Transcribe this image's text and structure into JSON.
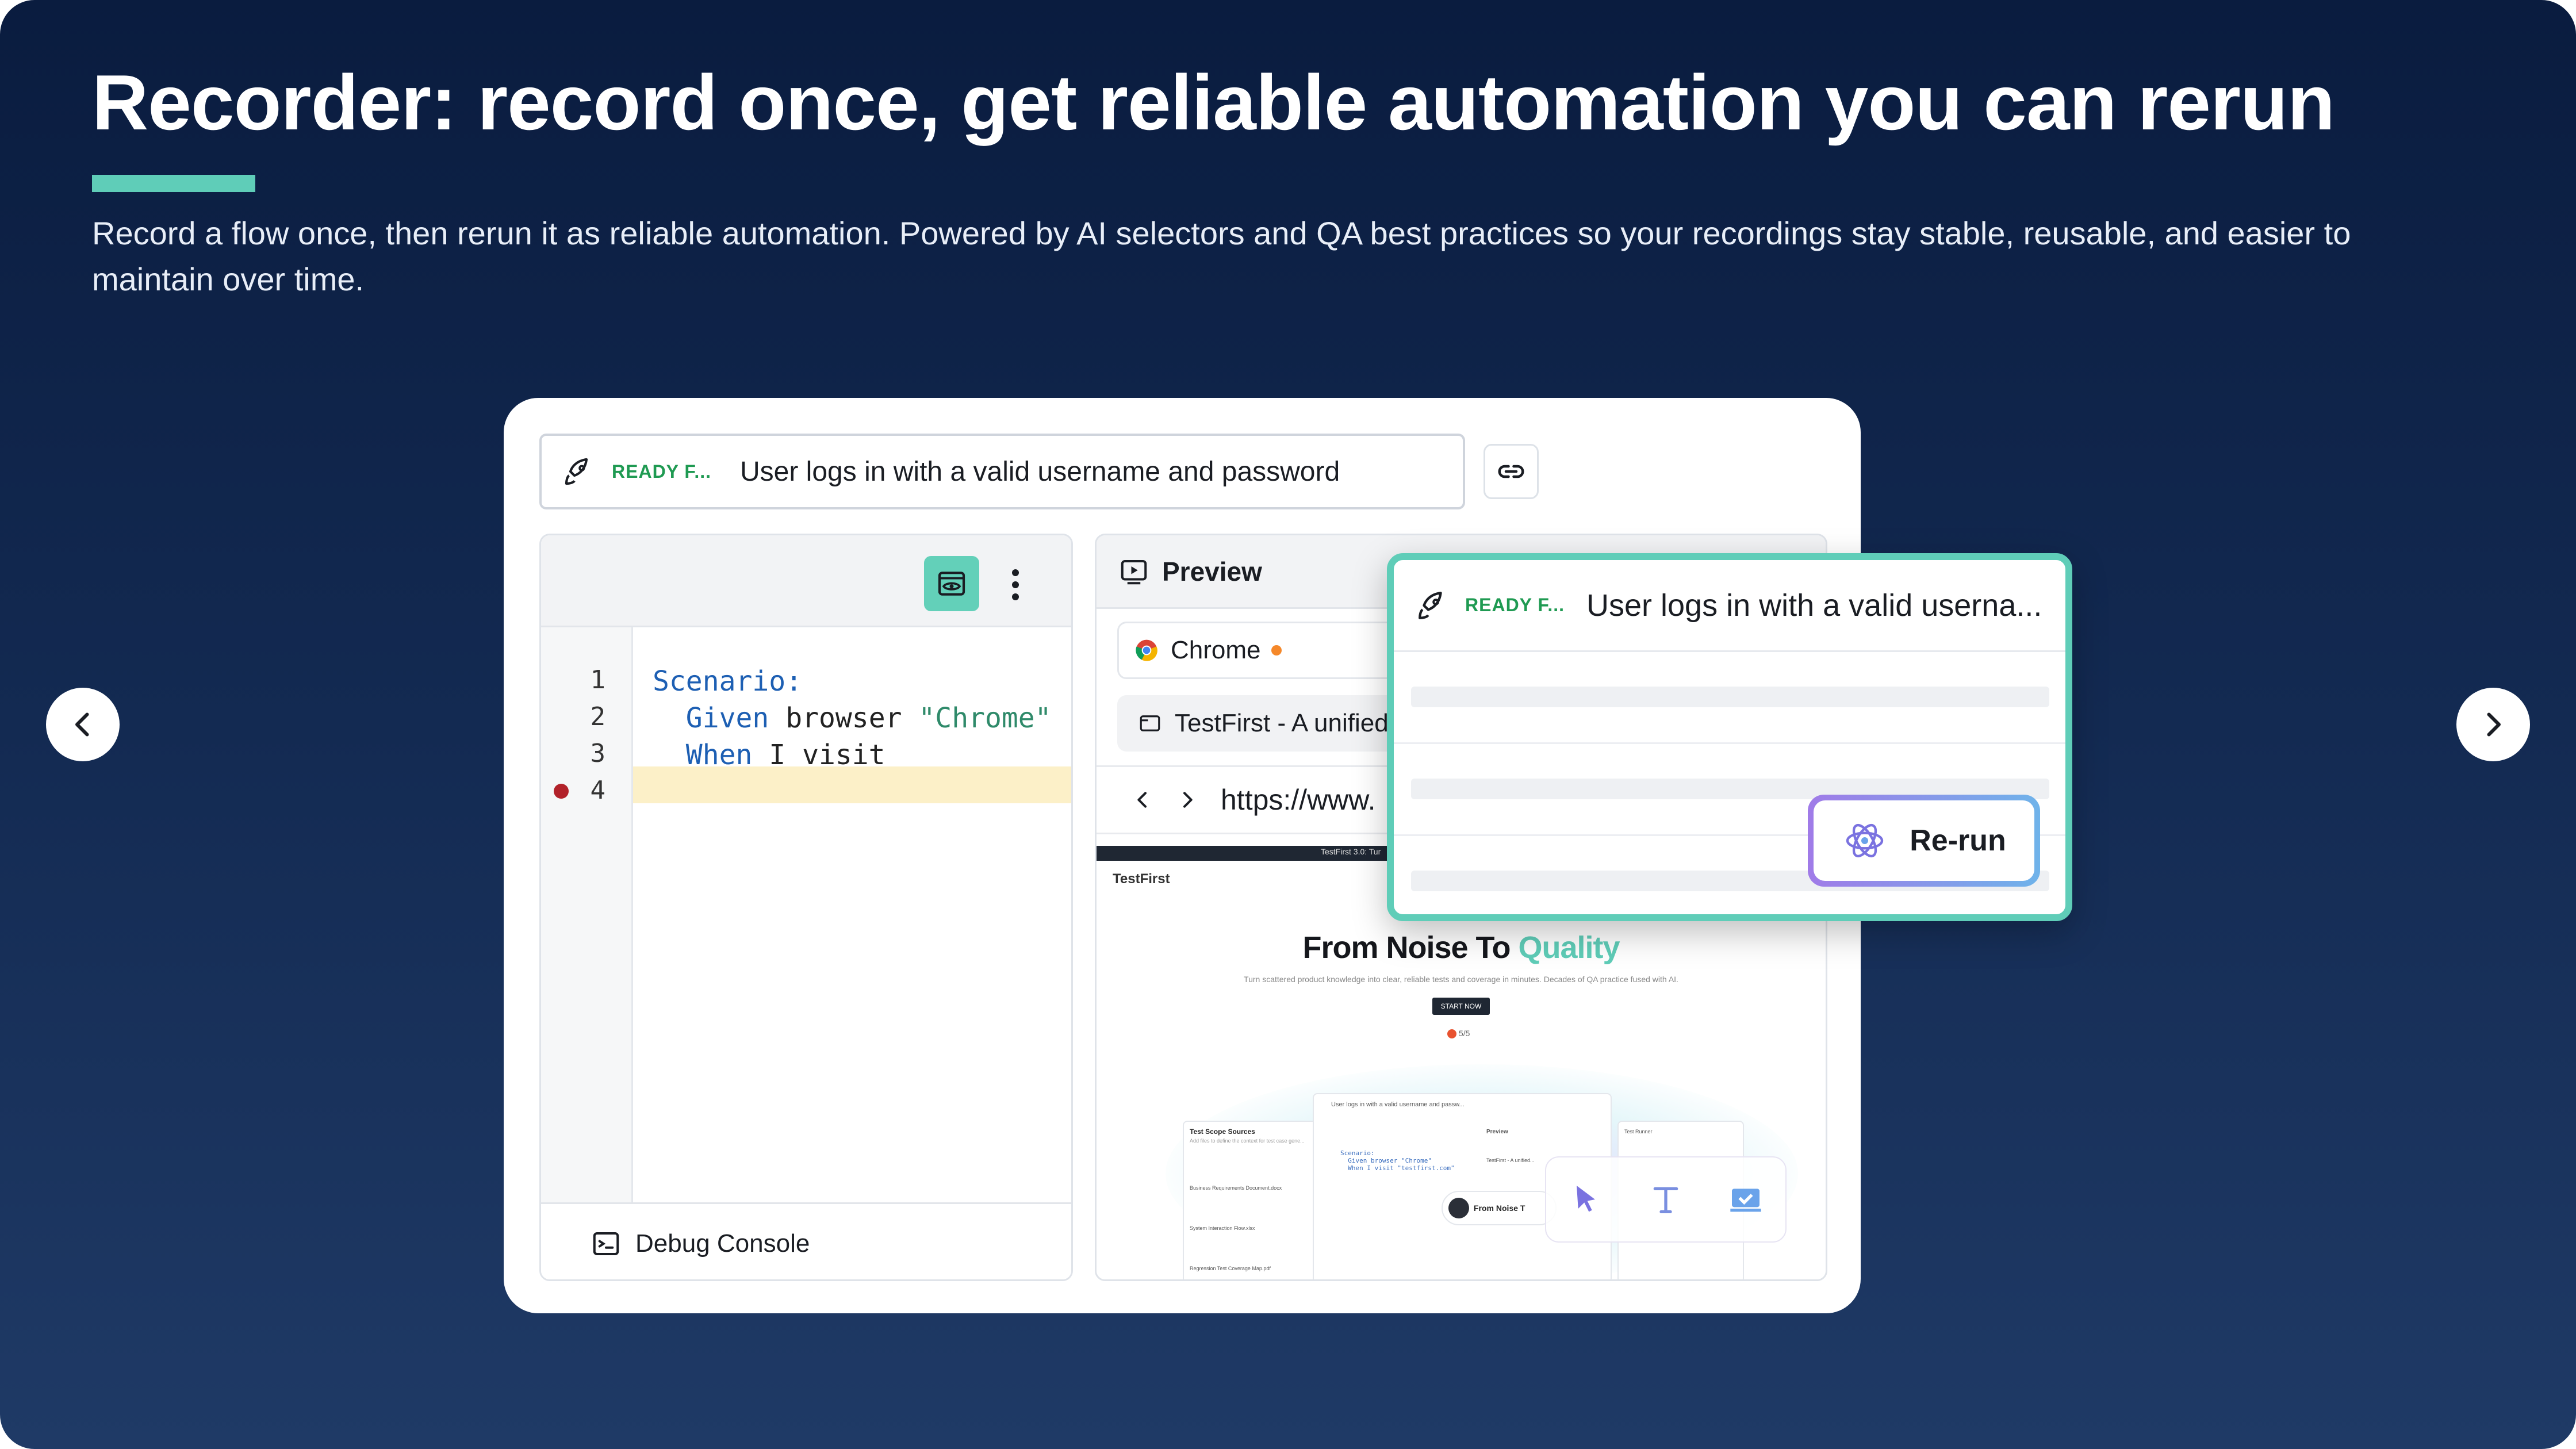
{
  "header": {
    "title": "Recorder: record once, get reliable automation you can rerun",
    "subtitle": "Record a flow once, then rerun it as reliable automation. Powered by AI selectors and QA best practices so your recordings stay stable, reusable, and easier to maintain over time."
  },
  "colors": {
    "accent": "#5fcdb8",
    "background_top": "#0a1c3f",
    "background_bottom": "#1f3a66",
    "ready_green": "#1f9a52",
    "breakpoint_red": "#b2222a"
  },
  "scenario_bar": {
    "status": "READY F...",
    "text": "User logs in with a valid username and password",
    "icon": "rocket-icon"
  },
  "editor": {
    "lines": [
      {
        "number": "1",
        "keyword": "Scenario:",
        "rest": "",
        "string": ""
      },
      {
        "number": "2",
        "keyword": "  Given",
        "rest": " browser ",
        "string": "\"Chrome\""
      },
      {
        "number": "3",
        "keyword": "  When",
        "rest": " I visit",
        "string": ""
      },
      {
        "number": "4",
        "keyword": "",
        "rest": "",
        "string": ""
      }
    ],
    "footer_label": "Debug Console"
  },
  "preview": {
    "title": "Preview",
    "browser_tab": "Chrome",
    "page_tab": "TestFirst - A unified",
    "url": "https://www.",
    "site": {
      "topbar_text": "TestFirst 3.0: Tur",
      "logo": "TestFirst",
      "hero_title_main": "From Noise To ",
      "hero_title_accent": "Quality",
      "hero_sub": "Turn scattered product knowledge into clear, reliable tests and coverage in minutes. Decades of QA practice fused with AI.",
      "hero_button": "START NOW",
      "rating": "5/5",
      "mini": {
        "scenario_text": "User logs in with a valid username and passw...",
        "scope_title": "Test Scope Sources",
        "scope_sub": "Add files to define the context for test case gene...",
        "doc1": "Business Requirements Document.docx",
        "doc2": "System Interaction Flow.xlsx",
        "doc3": "Regression Test Coverage Map.pdf",
        "code": "Scenario:\n  Given browser \"Chrome\"\n  When I visit \"testfirst.com\"",
        "preview_label": "Preview",
        "preview_tab": "TestFirst - A unified...",
        "play_label": "From Noise T",
        "right_label": "Test Runner"
      }
    }
  },
  "overlay": {
    "status": "READY F...",
    "text": "User logs in with a valid userna...",
    "button": "Re-run"
  }
}
